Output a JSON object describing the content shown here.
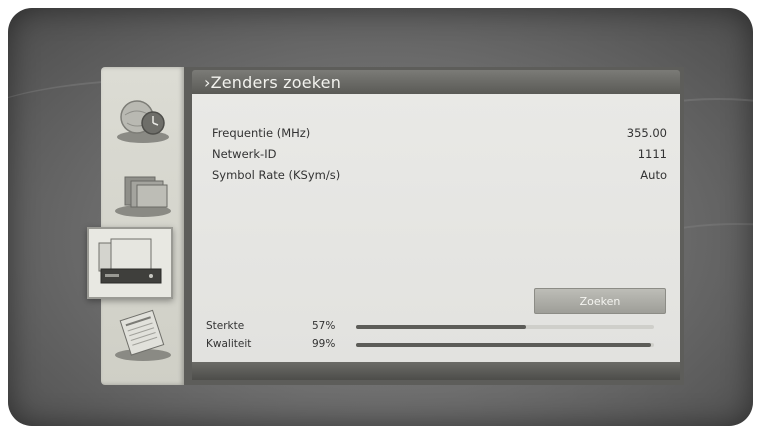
{
  "screen": {
    "title": "›Zenders zoeken"
  },
  "sidebar": {
    "items": [
      {
        "icon": "globe-clock-icon"
      },
      {
        "icon": "stack-icon"
      },
      {
        "icon": "receiver-icon",
        "selected": true
      },
      {
        "icon": "newspaper-icon"
      }
    ]
  },
  "settings": [
    {
      "label": "Frequentie (MHz)",
      "value": "355.00"
    },
    {
      "label": "Netwerk-ID",
      "value": "1111"
    },
    {
      "label": "Symbol Rate (KSym/s)",
      "value": "Auto"
    }
  ],
  "search_button": {
    "label": "Zoeken"
  },
  "meters": [
    {
      "label": "Sterkte",
      "percent_text": "57%",
      "level": 0.57
    },
    {
      "label": "Kwaliteit",
      "percent_text": "99%",
      "level": 0.99
    }
  ],
  "colors": {
    "panel_bg": "#e6e6e3",
    "header_bg": "#5e5e5a",
    "meter_fill": "#5c5c58"
  }
}
